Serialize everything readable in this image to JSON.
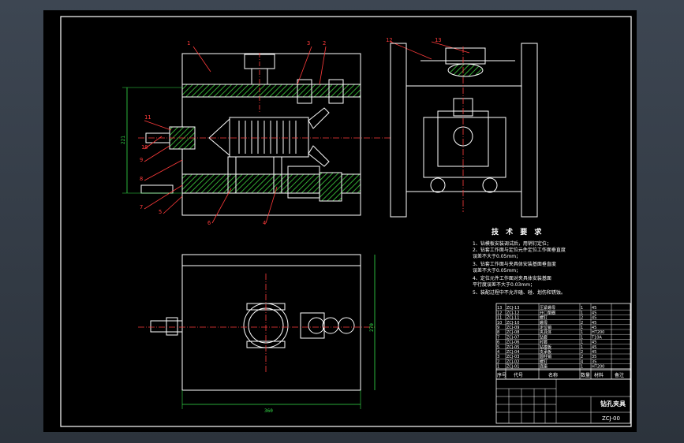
{
  "drawing": {
    "tech_title": "技 术 要 求",
    "tech_notes": [
      "1、钻模板安装调试后，用销钉定位；",
      "2、钻套工作面与定位元件定位工作面垂直度",
      "   误差不大于0.05mm；",
      "3、钻套工作面与夹具体安装基面垂直度",
      "   误差不大于0.05mm；",
      "4、定位元件工作面对夹具体安装基面",
      "   平行度误差不大于0.03mm；",
      "5、装配过程中不允许磕、碰、划伤和锈蚀。"
    ],
    "balloons": [
      "1",
      "3",
      "2",
      "11",
      "10",
      "9",
      "8",
      "7",
      "5",
      "6",
      "4",
      "12",
      "13"
    ],
    "dim_height": "221",
    "dim_width": "360",
    "dim_right": "270",
    "title_block": {
      "part_name": "钻孔夹具",
      "drawing_no": "ZCJ-00",
      "col_headers": [
        "序号",
        "代号",
        "名称",
        "数量",
        "材料",
        "备注"
      ]
    },
    "bom_rows": [
      [
        "13",
        "ZCJ-13",
        "压紧螺母",
        "1",
        "45"
      ],
      [
        "12",
        "ZCJ-12",
        "开口垫圈",
        "1",
        "45"
      ],
      [
        "11",
        "ZCJ-11",
        "螺钉",
        "2",
        "45"
      ],
      [
        "10",
        "ZCJ-10",
        "螺母",
        "2",
        "45"
      ],
      [
        "9",
        "ZCJ-09",
        "定位销",
        "1",
        "45"
      ],
      [
        "8",
        "ZCJ-08",
        "夹具体",
        "1",
        "HT200"
      ],
      [
        "7",
        "ZCJ-07",
        "钻套",
        "1",
        "T10A"
      ],
      [
        "6",
        "ZCJ-06",
        "衬套",
        "1",
        "45"
      ],
      [
        "5",
        "ZCJ-05",
        "钻模板",
        "1",
        "45"
      ],
      [
        "4",
        "ZCJ-04",
        "支承板",
        "2",
        "45"
      ],
      [
        "3",
        "ZCJ-03",
        "圆柱销",
        "2",
        "35"
      ],
      [
        "2",
        "ZCJ-02",
        "螺钉",
        "4",
        "35"
      ],
      [
        "1",
        "ZCJ-01",
        "底座",
        "1",
        "HT200"
      ]
    ],
    "colors": {
      "background": "#000000",
      "frame": "#ffffff",
      "outline": "#ffffff",
      "hatch": "#3fd23f",
      "dimension": "#35e04a",
      "leader": "#ff3b3b",
      "centerline": "#ff3b3b",
      "table_line": "#ffffff",
      "text": "#ffffff",
      "title_text": "#ffffff",
      "tech_text": "#ffffff"
    }
  }
}
